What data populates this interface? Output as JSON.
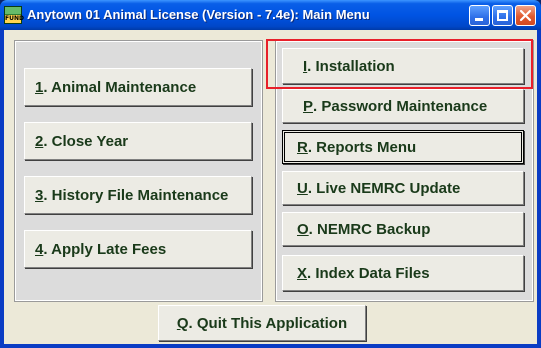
{
  "window": {
    "title": "Anytown 01 Animal License (Version - 7.4e):  Main Menu",
    "icon_label": "FUND",
    "controls": {
      "minimize": "minimize-icon",
      "maximize": "maximize-icon",
      "close": "close-icon"
    }
  },
  "left_menu": [
    {
      "key": "1",
      "label": ". Animal Maintenance"
    },
    {
      "key": "2",
      "label": ".  Close Year"
    },
    {
      "key": "3",
      "label": ". History File Maintenance"
    },
    {
      "key": "4",
      "label": ".  Apply Late Fees"
    }
  ],
  "right_menu": [
    {
      "key": "I",
      "label": ".  Installation"
    },
    {
      "key": "P",
      "label": ".  Password Maintenance"
    },
    {
      "key": "R",
      "label": ".  Reports Menu"
    },
    {
      "key": "U",
      "label": ". Live NEMRC Update"
    },
    {
      "key": "O",
      "label": ". NEMRC Backup"
    },
    {
      "key": "X",
      "label": ".  Index Data Files"
    }
  ],
  "quit": {
    "key": "Q",
    "label": ".  Quit This Application"
  },
  "colors": {
    "highlight": "#e8202a",
    "text": "#1a3a1a",
    "titlebar": "#0054e3"
  }
}
